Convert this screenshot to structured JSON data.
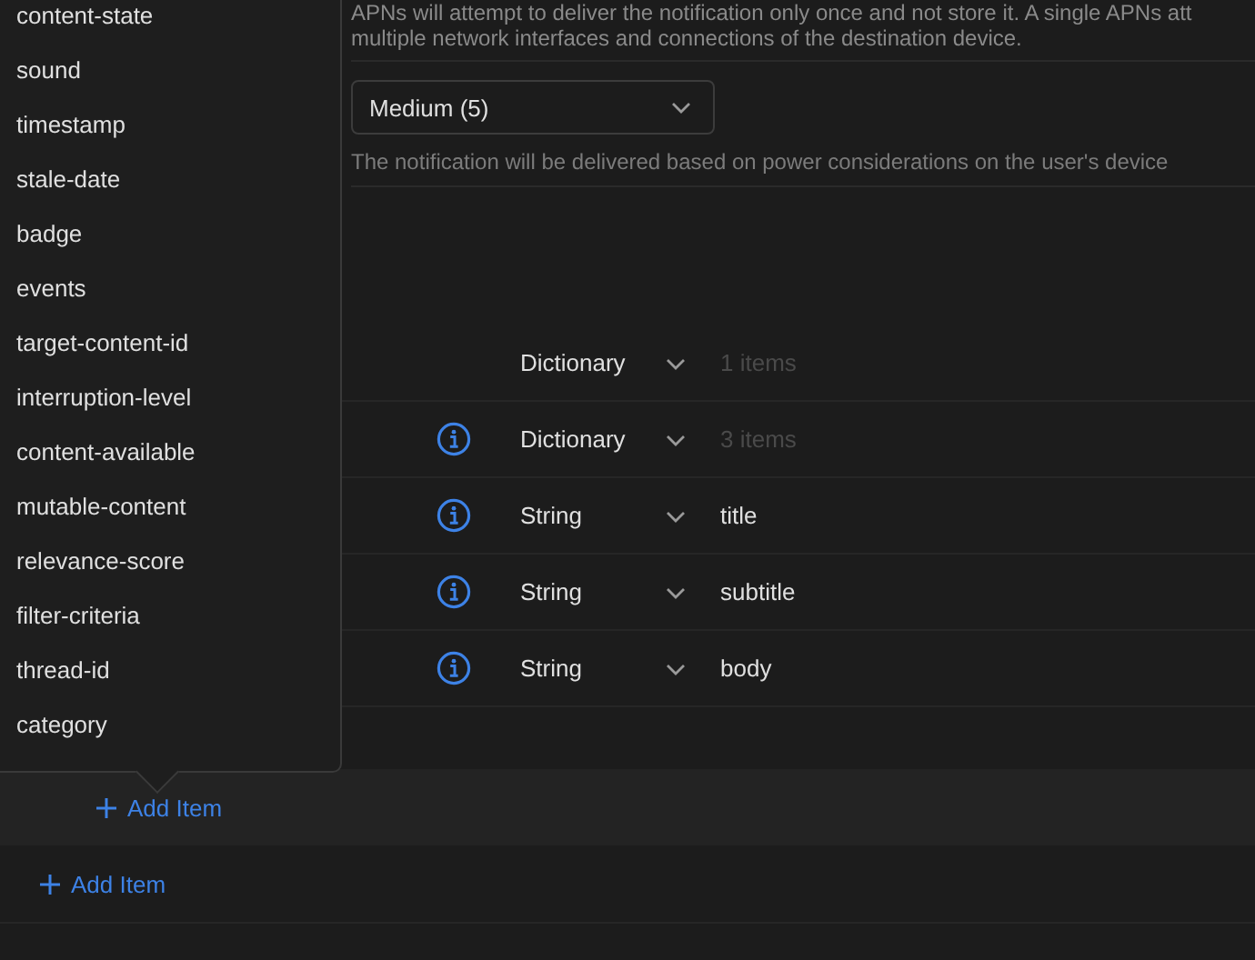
{
  "description": "APNs will attempt to deliver the notification only once and not store it. A single APNs att",
  "description_line_2": "multiple network interfaces and connections of the destination device.",
  "priority_dropdown": {
    "value": "Medium (5)"
  },
  "priority_hint": "The notification will be delivered based on power considerations on the user's device",
  "rows": [
    {
      "info": false,
      "type": "Dictionary",
      "value": "1 items",
      "muted": true
    },
    {
      "info": true,
      "type": "Dictionary",
      "value": "3 items",
      "muted": true
    },
    {
      "info": true,
      "type": "String",
      "value": "title",
      "muted": false
    },
    {
      "info": true,
      "type": "String",
      "value": "subtitle",
      "muted": false
    },
    {
      "info": true,
      "type": "String",
      "value": "body",
      "muted": false
    }
  ],
  "popup_menu": {
    "items": [
      "content-state",
      "sound",
      "timestamp",
      "stale-date",
      "badge",
      "events",
      "target-content-id",
      "interruption-level",
      "content-available",
      "mutable-content",
      "relevance-score",
      "filter-criteria",
      "thread-id",
      "category"
    ]
  },
  "add_item_buttons": [
    {
      "label": "Add Item",
      "nested": true
    },
    {
      "label": "Add Item",
      "nested": false
    }
  ]
}
